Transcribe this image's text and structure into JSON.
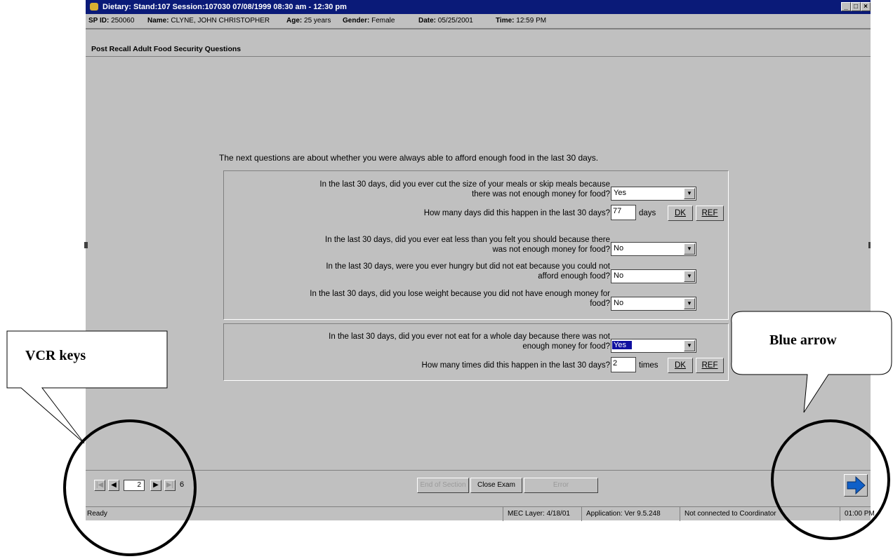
{
  "window": {
    "title": "Dietary: Stand:107 Session:107030 07/08/1999 08:30 am - 12:30 pm",
    "controls": [
      "_",
      "□",
      "×"
    ]
  },
  "info": {
    "sp_id_label": "SP ID:",
    "sp_id": "250060",
    "name_label": "Name:",
    "name": "CLYNE, JOHN CHRISTOPHER",
    "age_label": "Age:",
    "age": "25 years",
    "gender_label": "Gender:",
    "gender": "Female",
    "date_label": "Date:",
    "date": "05/25/2001",
    "time_label": "Time:",
    "time": "12:59 PM"
  },
  "section_title": "Post Recall Adult Food Security Questions",
  "intro": "The next questions are about whether you were always able to afford enough food in the last 30 days.",
  "group1": {
    "q1_line1": "In the last 30 days, did you ever cut the size of your meals or skip meals because",
    "q1_line2": "there was not enough money for food?",
    "q1_value": "Yes",
    "q1a": "How many days did this happen in the last 30 days?",
    "q1a_value": "77",
    "q1a_unit": "days",
    "q2_line1": "In the last 30 days, did you ever eat less than you felt you should because there",
    "q2_line2": "was not enough money for food?",
    "q2_value": "No",
    "q3_line1": "In the last 30 days, were you ever hungry but did not eat because you could not",
    "q3_line2": "afford enough food?",
    "q3_value": "No",
    "q4_line1": "In the last 30 days, did you lose weight because you did not have enough money for",
    "q4_line2": "food?",
    "q4_value": "No"
  },
  "group2": {
    "q5_line1": "In the last 30 days, did you ever not eat for a whole day because there was not",
    "q5_line2": "enough money for food?",
    "q5_value": "Yes",
    "q5a": "How many times did this happen in the last 30 days?",
    "q5a_value": "2",
    "q5a_unit": "times"
  },
  "buttons": {
    "dk": "DK",
    "ref": "REF"
  },
  "nav": {
    "page": "2",
    "total": "6",
    "end_section": "End of Section",
    "close_exam": "Close Exam",
    "error": "Error"
  },
  "status": {
    "ready": "Ready",
    "mec": "MEC Layer: 4/18/01",
    "app": "Application: Ver 9.5.248",
    "conn": "Not connected to Coordinator",
    "clock": "01:00 PM"
  },
  "annotations": {
    "vcr": "VCR keys",
    "blue_arrow": "Blue arrow"
  },
  "colors": {
    "titlebar": "#0a1a78",
    "selection": "#1010a0",
    "window": "#c0c0c0",
    "next_arrow": "#1060c8"
  }
}
